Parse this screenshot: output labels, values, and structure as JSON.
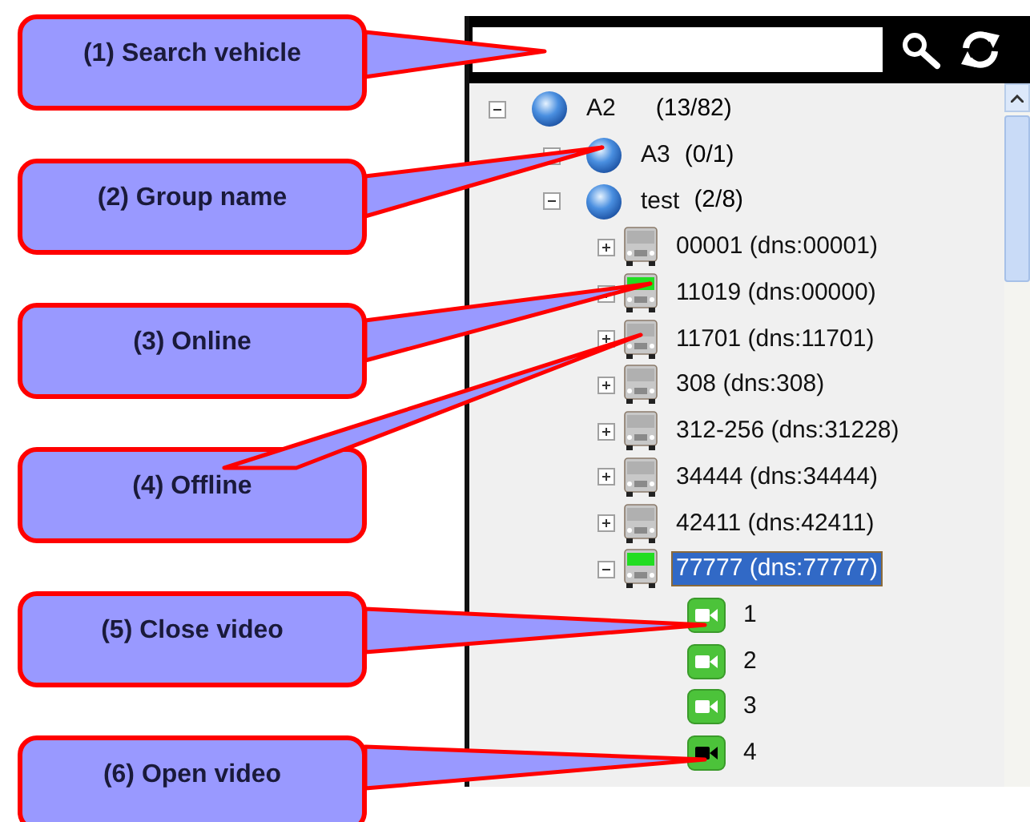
{
  "callouts": [
    {
      "text": "(1) Search vehicle"
    },
    {
      "text": "(2) Group name"
    },
    {
      "text": "(3) Online"
    },
    {
      "text": "(4) Offline"
    },
    {
      "text": "(5) Close video"
    },
    {
      "text": "(6) Open video"
    }
  ],
  "tree": [
    {
      "kind": "group",
      "label": "A2",
      "count": "(13/82)",
      "expanded": true,
      "selected": false,
      "children": [
        {
          "kind": "group",
          "label": "A3",
          "count": "(0/1)",
          "expanded": false,
          "selected": false
        },
        {
          "kind": "group",
          "label": "test",
          "count": "(2/8)",
          "expanded": true,
          "selected": false,
          "children": [
            {
              "kind": "vehicle",
              "label": "00001 (dns:00001)",
              "online": false,
              "expanded": false,
              "selected": false
            },
            {
              "kind": "vehicle",
              "label": "11019 (dns:00000)",
              "online": true,
              "expanded": false,
              "selected": false
            },
            {
              "kind": "vehicle",
              "label": "11701 (dns:11701)",
              "online": false,
              "expanded": false,
              "selected": false
            },
            {
              "kind": "vehicle",
              "label": "308 (dns:308)",
              "online": false,
              "expanded": false,
              "selected": false
            },
            {
              "kind": "vehicle",
              "label": "312-256 (dns:31228)",
              "online": false,
              "expanded": false,
              "selected": false
            },
            {
              "kind": "vehicle",
              "label": "34444 (dns:34444)",
              "online": false,
              "expanded": false,
              "selected": false
            },
            {
              "kind": "vehicle",
              "label": "42411 (dns:42411)",
              "online": false,
              "expanded": false,
              "selected": false
            },
            {
              "kind": "vehicle",
              "label": "77777 (dns:77777)",
              "online": true,
              "expanded": true,
              "selected": true,
              "children": [
                {
                  "kind": "camera",
                  "label": "1",
                  "video_open": false,
                  "selected": false
                },
                {
                  "kind": "camera",
                  "label": "2",
                  "video_open": false,
                  "selected": false
                },
                {
                  "kind": "camera",
                  "label": "3",
                  "video_open": false,
                  "selected": false
                },
                {
                  "kind": "camera",
                  "label": "4",
                  "video_open": true,
                  "selected": false
                }
              ]
            }
          ]
        }
      ]
    }
  ]
}
